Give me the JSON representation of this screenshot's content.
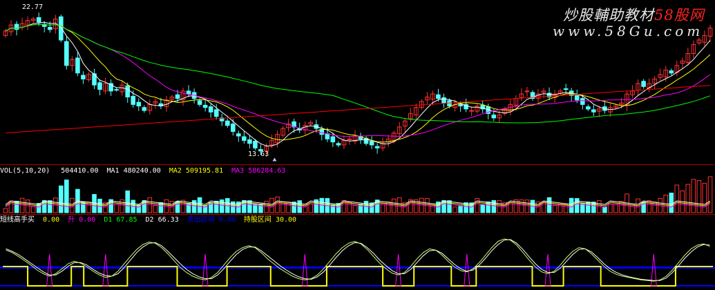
{
  "watermark": {
    "title": "炒股輔助教材",
    "title_accent": "58股网",
    "url": "www.58Gu.com"
  },
  "price_panel": {
    "high_label": "22.77",
    "low_label": "13.63"
  },
  "volume_panel": {
    "name": "VOL(5,10,20)",
    "fields": [
      {
        "label": "",
        "value": "504410.00",
        "color": "#ffffff"
      },
      {
        "label": "MA1",
        "value": "480240.00",
        "color": "#ffffff"
      },
      {
        "label": "MA2",
        "value": "509195.81",
        "color": "#ffff00"
      },
      {
        "label": "MA3",
        "value": "586284.63",
        "color": "#ff00ff"
      }
    ]
  },
  "indicator_panel": {
    "name": "短线高手买",
    "fields": [
      {
        "label": "",
        "value": "0.00",
        "color": "#ffff00"
      },
      {
        "label": "升",
        "value": "0.00",
        "color": "#ff00ff"
      },
      {
        "label": "D1",
        "value": "67.85",
        "color": "#00ff00"
      },
      {
        "label": "D2",
        "value": "66.33",
        "color": "#ffffff"
      },
      {
        "label": "卖出区间",
        "value": "0.00",
        "color": "#0000ff"
      },
      {
        "label": "持股区间",
        "value": "30.00",
        "color": "#ffff00"
      }
    ]
  },
  "colors": {
    "up": "#ff3232",
    "down": "#54ffff",
    "ma_white": "#ffffff",
    "ma_yellow": "#ffff00",
    "ma_magenta": "#ff00ff",
    "ma_green": "#00ff00",
    "ma_red": "#ff0000",
    "sell_zone": "#0000ff",
    "hold_line": "#ffff00"
  },
  "chart_data": [
    {
      "type": "candlestick",
      "title": "",
      "ylim": [
        13,
        23.5
      ],
      "annotations": [
        "22.77",
        "13.63"
      ],
      "close": [
        21.8,
        22.2,
        21.9,
        22.3,
        22.5,
        22.6,
        22.4,
        22.1,
        21.9,
        22.6,
        21.2,
        19.5,
        19.9,
        19.0,
        18.6,
        18.9,
        18.2,
        17.9,
        18.3,
        17.8,
        17.9,
        18.2,
        17.4,
        16.9,
        16.8,
        16.5,
        16.9,
        17.1,
        16.8,
        17.2,
        17.4,
        17.3,
        17.8,
        17.6,
        17.3,
        16.9,
        16.7,
        16.4,
        16.1,
        15.8,
        15.5,
        15.1,
        14.8,
        14.5,
        14.3,
        14.0,
        13.8,
        14.1,
        14.5,
        14.9,
        15.3,
        15.6,
        15.4,
        15.2,
        15.5,
        15.7,
        15.3,
        14.9,
        14.6,
        14.4,
        14.2,
        14.5,
        14.6,
        14.8,
        14.6,
        14.3,
        14.2,
        14.0,
        14.3,
        14.6,
        15.0,
        15.4,
        15.8,
        16.3,
        16.7,
        17.1,
        17.4,
        17.6,
        17.3,
        17.0,
        16.8,
        16.9,
        16.8,
        16.6,
        16.5,
        16.8,
        16.6,
        16.3,
        16.0,
        16.2,
        16.6,
        16.9,
        17.3,
        17.6,
        17.8,
        17.3,
        17.6,
        17.8,
        17.4,
        17.6,
        17.8,
        17.9,
        17.5,
        17.2,
        16.9,
        16.6,
        16.4,
        16.6,
        16.5,
        16.7,
        16.8,
        17.0,
        17.6,
        17.8,
        18.3,
        18.1,
        18.3,
        18.6,
        18.9,
        19.2,
        19.0,
        19.5,
        19.8,
        20.3,
        20.9,
        21.2,
        21.5,
        22.0
      ],
      "high_annotation": 22.77,
      "low_annotation": 13.63
    },
    {
      "type": "bar",
      "title": "VOL(5,10,20)",
      "series": [
        {
          "name": "VOL",
          "values": []
        },
        {
          "name": "MA1",
          "values": []
        },
        {
          "name": "MA2",
          "values": []
        },
        {
          "name": "MA3",
          "values": []
        }
      ],
      "last_values": {
        "VOL": 504410.0,
        "MA1": 480240.0,
        "MA2": 509195.81,
        "MA3": 586284.63
      }
    },
    {
      "type": "line",
      "title": "短线高手买",
      "ylim": [
        0,
        100
      ],
      "series": [
        {
          "name": "D1",
          "values": [
            62,
            58,
            52,
            45,
            38,
            30,
            24,
            20,
            24,
            32,
            40,
            44,
            41,
            35,
            28,
            22,
            18,
            20,
            28,
            40,
            52,
            63,
            71,
            75,
            73,
            66,
            56,
            45,
            34,
            26,
            20,
            16,
            14,
            18,
            26,
            38,
            50,
            60,
            66,
            69,
            66,
            58,
            48,
            40,
            32,
            26,
            20,
            16,
            14,
            16,
            22,
            32,
            44,
            56,
            66,
            73,
            76,
            72,
            63,
            52,
            41,
            32,
            25,
            22,
            26,
            36,
            48,
            58,
            64,
            62,
            54,
            44,
            35,
            29,
            27,
            32,
            42,
            54,
            66,
            76,
            80,
            78,
            70,
            58,
            46,
            35,
            27,
            24,
            28,
            38,
            50,
            60,
            66,
            64,
            56,
            46,
            36,
            28,
            23,
            20,
            18,
            16,
            14,
            13,
            12,
            14,
            20,
            30,
            42,
            54,
            64,
            70,
            72,
            68
          ]
        },
        {
          "name": "D2",
          "values": [
            64,
            60,
            55,
            48,
            41,
            34,
            27,
            22,
            22,
            28,
            36,
            42,
            42,
            38,
            31,
            25,
            21,
            20,
            24,
            34,
            46,
            58,
            67,
            73,
            74,
            69,
            60,
            50,
            40,
            31,
            24,
            19,
            16,
            16,
            22,
            32,
            44,
            55,
            63,
            67,
            67,
            61,
            53,
            45,
            37,
            30,
            24,
            19,
            16,
            15,
            19,
            27,
            38,
            50,
            61,
            69,
            74,
            73,
            66,
            57,
            46,
            37,
            29,
            24,
            24,
            31,
            42,
            53,
            61,
            62,
            57,
            48,
            39,
            32,
            28,
            30,
            38,
            49,
            61,
            71,
            78,
            79,
            73,
            63,
            51,
            40,
            31,
            26,
            26,
            33,
            44,
            55,
            63,
            64,
            59,
            50,
            40,
            32,
            26,
            22,
            19,
            17,
            15,
            14,
            13,
            13,
            17,
            26,
            37,
            49,
            59,
            67,
            71,
            70
          ]
        }
      ],
      "last_values": {
        "D1": 67.85,
        "D2": 66.33,
        "短线高手买": 0.0,
        "升": 0.0,
        "卖出区间": 0.0,
        "持股区间": 30.0
      }
    }
  ]
}
